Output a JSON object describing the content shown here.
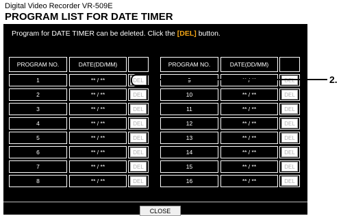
{
  "app_title": "Digital Video Recorder VR-509E",
  "page_title": "PROGRAM LIST FOR DATE TIMER",
  "instruction": {
    "prefix": "Program for DATE TIMER can be deleted. Click the ",
    "key": "[DEL]",
    "suffix": " button."
  },
  "table": {
    "headers": {
      "program_no": "PROGRAM NO.",
      "date": "DATE(DD/MM)"
    },
    "left_rows": [
      {
        "no": "1",
        "date": "** / **",
        "del": "DEL"
      },
      {
        "no": "2",
        "date": "** / **",
        "del": "DEL"
      },
      {
        "no": "3",
        "date": "** / **",
        "del": "DEL"
      },
      {
        "no": "4",
        "date": "** / **",
        "del": "DEL"
      },
      {
        "no": "5",
        "date": "** / **",
        "del": "DEL"
      },
      {
        "no": "6",
        "date": "** / **",
        "del": "DEL"
      },
      {
        "no": "7",
        "date": "** / **",
        "del": "DEL"
      },
      {
        "no": "8",
        "date": "** / **",
        "del": "DEL"
      }
    ],
    "right_rows": [
      {
        "no": "9",
        "date": "** / **",
        "del": "DEL"
      },
      {
        "no": "10",
        "date": "** / **",
        "del": "DEL"
      },
      {
        "no": "11",
        "date": "** / **",
        "del": "DEL"
      },
      {
        "no": "12",
        "date": "** / **",
        "del": "DEL"
      },
      {
        "no": "13",
        "date": "** / **",
        "del": "DEL"
      },
      {
        "no": "14",
        "date": "** / **",
        "del": "DEL"
      },
      {
        "no": "15",
        "date": "** / **",
        "del": "DEL"
      },
      {
        "no": "16",
        "date": "** / **",
        "del": "DEL"
      }
    ]
  },
  "close_label": "CLOSE",
  "callout": {
    "label": "2."
  },
  "colors": {
    "background": "#000000",
    "accent": "#f2a516",
    "text": "#ffffff"
  }
}
